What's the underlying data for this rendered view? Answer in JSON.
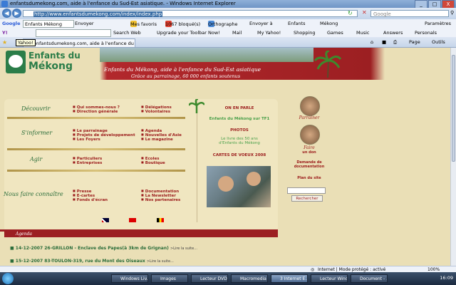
{
  "window": {
    "title": "enfantsdumekong.com, aide à l'enfance du Sud-Est asiatique. - Windows Internet Explorer",
    "buttons": [
      "_",
      "□",
      "X"
    ]
  },
  "address_bar": {
    "url": "http://www.enfantsdumekong.com/index/index.php",
    "search_placeholder": "Google"
  },
  "google_toolbar": {
    "label": "Google",
    "query": "Enfants Mékong",
    "send": "Envoyer",
    "favorites": "Mes favoris",
    "blocked": "1067 bloqué(s)",
    "spelling": "Orthographe",
    "send_to": "Envoyer à",
    "link1": "Enfants",
    "link2": "Mékong",
    "settings": "Paramètres"
  },
  "yahoo_toolbar": {
    "search_web": "Search Web",
    "upgrade": "Upgrade your Toolbar Now!",
    "mail": "Mail",
    "my_yahoo": "My Yahoo!",
    "shopping": "Shopping",
    "games": "Games",
    "music": "Music",
    "answers": "Answers",
    "personals": "Personals"
  },
  "tabs": {
    "active": "enfantsdumekong.com, aide à l'enfance du Sud-...",
    "tooltip": "Yahoo!",
    "page_menu": "Page",
    "tools_menu": "Outils"
  },
  "site": {
    "logo_line1": "Enfants du",
    "logo_line2": "Mékong",
    "tagline": "Enfants du Mékong, aide à l'enfance du Sud-Est asiatique",
    "subtagline": "Grâce au parrainage, 60 000 enfants soutenus"
  },
  "nav": {
    "sections": [
      {
        "title": "Découvrir",
        "col1": [
          "Qui sommes-nous ?",
          "Direction générale"
        ],
        "col2": [
          "Délégations",
          "Volontaires"
        ]
      },
      {
        "title": "S'informer",
        "col1": [
          "Le parrainage",
          "Projets de développement",
          "Les Foyers"
        ],
        "col2": [
          "Agenda",
          "Nouvelles d'Asie",
          "Le magazine"
        ]
      },
      {
        "title": "Agir",
        "col1": [
          "Particuliers",
          "Entreprises"
        ],
        "col2": [
          "Ecoles",
          "Boutique"
        ]
      },
      {
        "title": "Nous faire connaître",
        "col1": [
          "Presse",
          "E-cartes",
          "Fonds d'écran"
        ],
        "col2": [
          "Documentation",
          "La Newsletter",
          "Nos partenaires"
        ]
      }
    ]
  },
  "center": {
    "press_title": "ON EN PARLE",
    "press_item": "Enfants du Mékong sur TF1",
    "photos_title": "PHOTOS",
    "photos_line1": "Le livre des 50 ans",
    "photos_line2": "d'Enfants du Mékong",
    "cards_title": "CARTES DE VOEUX 2008"
  },
  "right": {
    "sponsor": "Parrainer",
    "give_line1": "Faire",
    "give_line2": "un don",
    "docs_line1": "Demande de",
    "docs_line2": "documentation",
    "sitemap": "Plan du site",
    "search_button": "Rechercher"
  },
  "agenda": {
    "title": "Agenda",
    "items": [
      {
        "date": "14-12-2007",
        "text": "26-GRILLON - Enclave des Papes(à 3km de Grignan)",
        "more": ">Lire la suite..."
      },
      {
        "date": "15-12-2007",
        "text": "83-TOULON-319, rue du Mont des Oiseaux",
        "more": ">Lire la suite..."
      }
    ]
  },
  "status": {
    "zone": "Internet | Mode protégé : activé",
    "zoom": "100%"
  },
  "taskbar": {
    "items": [
      "Windows Liv...",
      "Images",
      "Lecteur DVD ...",
      "Macromedia ...",
      "3 Internet E...",
      "Lecteur Wind...",
      "Document - ..."
    ],
    "clock": "16:09"
  },
  "colors": {
    "brand_red": "#9c1f22",
    "brand_green": "#2b7d49",
    "page_bg": "#eadfb6"
  }
}
